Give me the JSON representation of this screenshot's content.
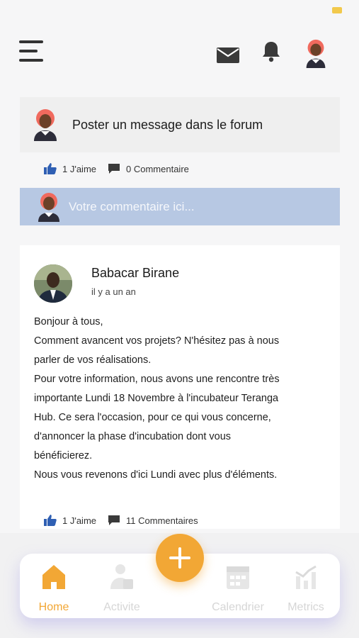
{
  "compose": {
    "prompt": "Poster un message dans le forum"
  },
  "first_post_stats": {
    "likes": "1 J'aime",
    "comments": "0 Commentaire"
  },
  "comment_input": {
    "placeholder": "Votre commentaire ici..."
  },
  "post": {
    "author": "Babacar Birane",
    "time": "il y a un an",
    "lines": [
      "Bonjour à tous,",
      "Comment avancent vos projets? N'hésitez pas à nous",
      "parler de vos réalisations.",
      "Pour votre information, nous avons une rencontre très",
      "importante Lundi 18 Novembre à l'incubateur Teranga",
      "Hub. Ce sera l'occasion, pour ce qui vous concerne,",
      "d'annoncer la phase d'incubation dont vous",
      "bénéficierez.",
      "Nous vous revenons d'ici Lundi avec plus d'éléments."
    ],
    "likes": "1 J'aime",
    "comments": "11 Commentaires"
  },
  "nav": {
    "home": "Home",
    "activity": "Activite",
    "calendar": "Calendrier",
    "metrics": "Metrics"
  },
  "colors": {
    "accent": "#f2a735",
    "like_blue": "#2f5fb3",
    "comment_bar": "#b7c8e3"
  },
  "icons": [
    "menu-icon",
    "mail-icon",
    "bell-icon",
    "avatar",
    "thumbs-up-icon",
    "comment-icon",
    "plus-icon",
    "home-icon",
    "activity-icon",
    "calendar-icon",
    "metrics-icon"
  ]
}
